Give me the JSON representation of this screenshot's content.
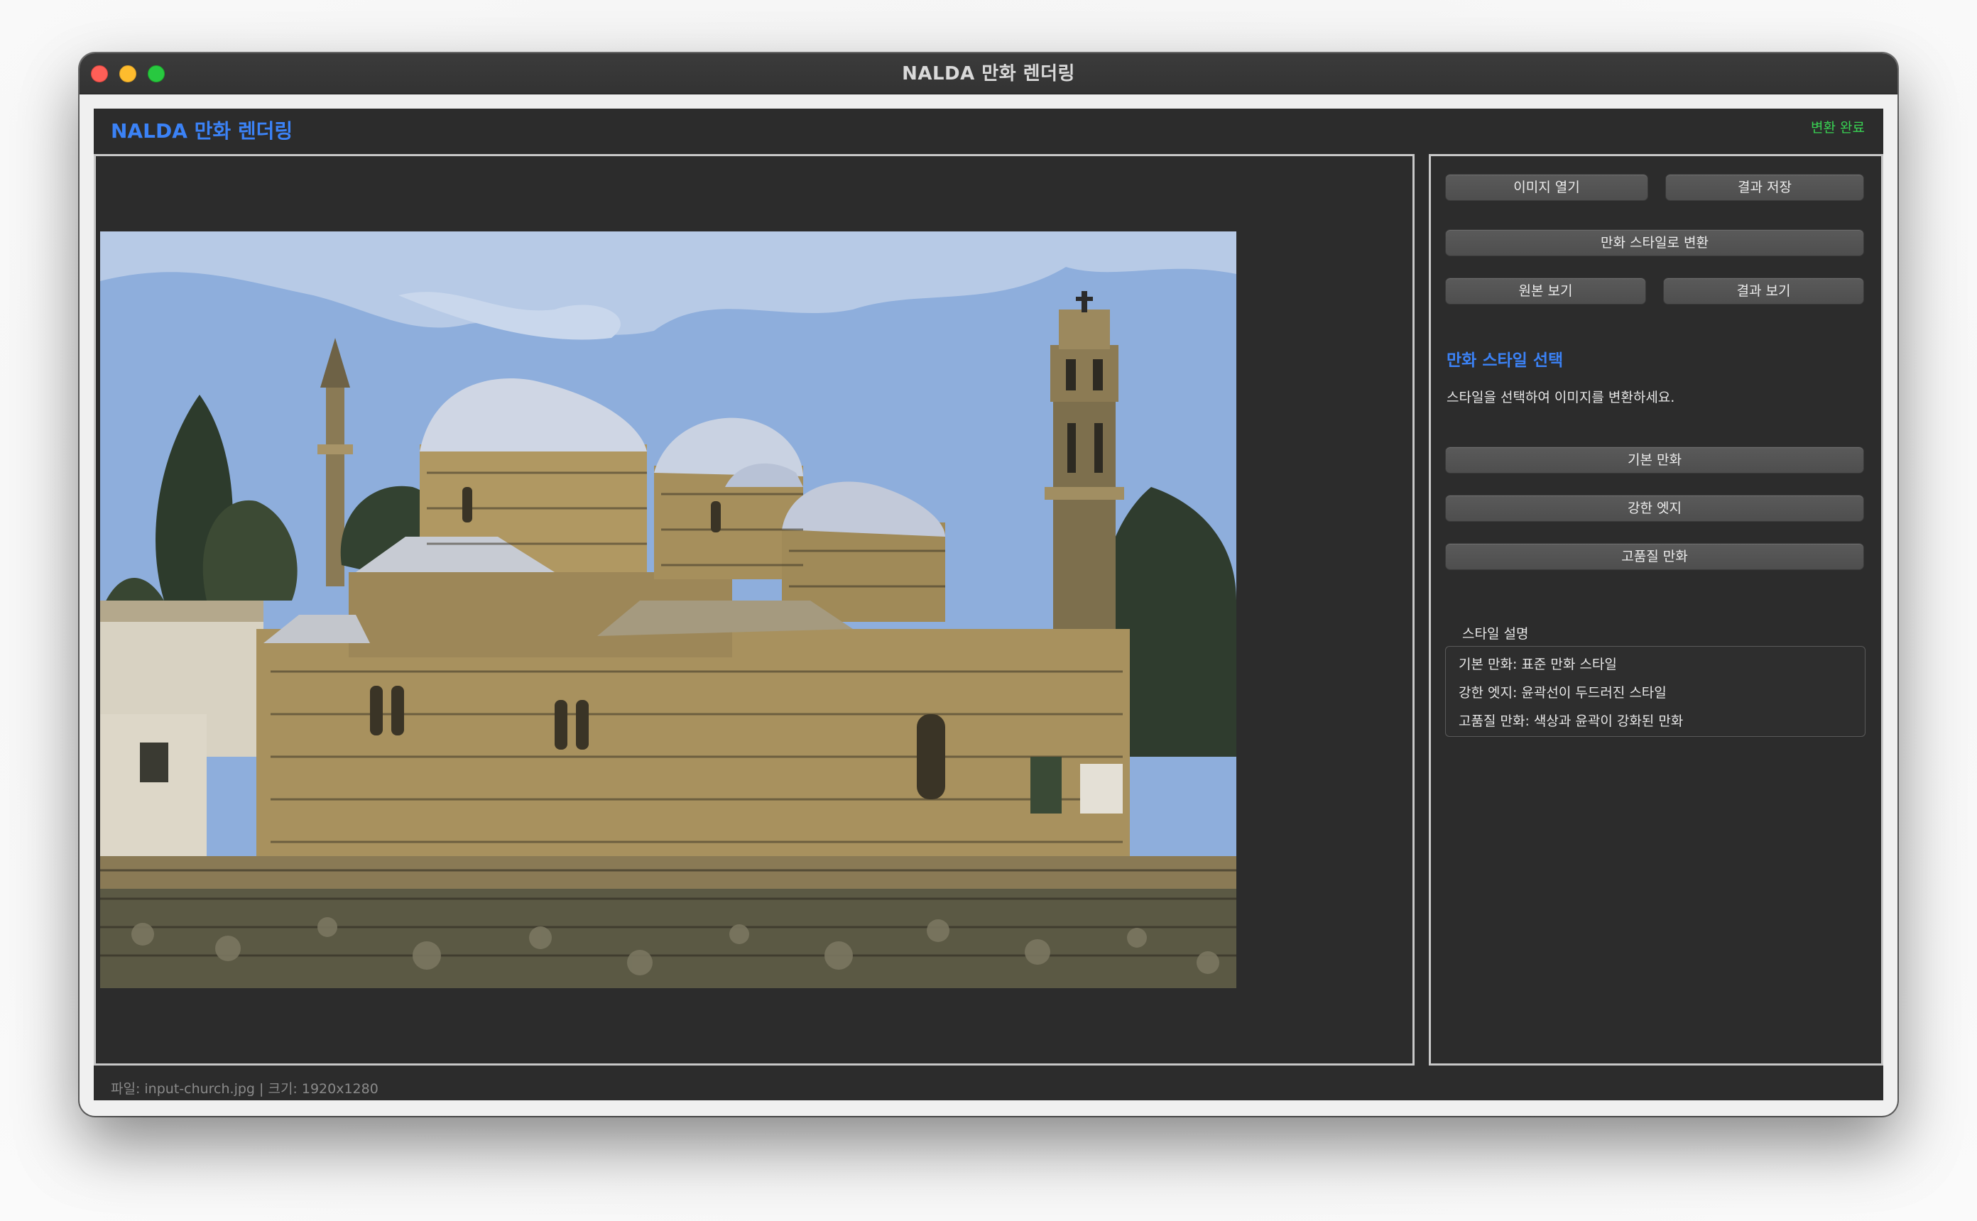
{
  "window": {
    "title": "NALDA 만화 렌더링"
  },
  "header": {
    "app_title": "NALDA 만화 렌더링",
    "status": "변환 완료"
  },
  "toolbar": {
    "open_image": "이미지 열기",
    "save_result": "결과 저장",
    "convert": "만화 스타일로 변환",
    "view_original": "원본 보기",
    "view_result": "결과 보기"
  },
  "styles": {
    "heading": "만화 스타일 선택",
    "hint": "스타일을 선택하여 이미지를 변환하세요.",
    "options": [
      "기본 만화",
      "강한 엣지",
      "고품질 만화"
    ]
  },
  "description": {
    "label": "스타일 설명",
    "lines": [
      "기본 만화: 표준 만화 스타일",
      "강한 엣지: 윤곽선이 두드러진 스타일",
      "고품질 만화: 색상과 윤곽이 강화된 만화"
    ]
  },
  "footer": {
    "file_info": "파일: input-church.jpg | 크기: 1920x1280"
  },
  "colors": {
    "accent": "#3b82f6",
    "status_green": "#39d353",
    "panel_bg": "#2c2c2c",
    "button_bg": "#555555"
  }
}
